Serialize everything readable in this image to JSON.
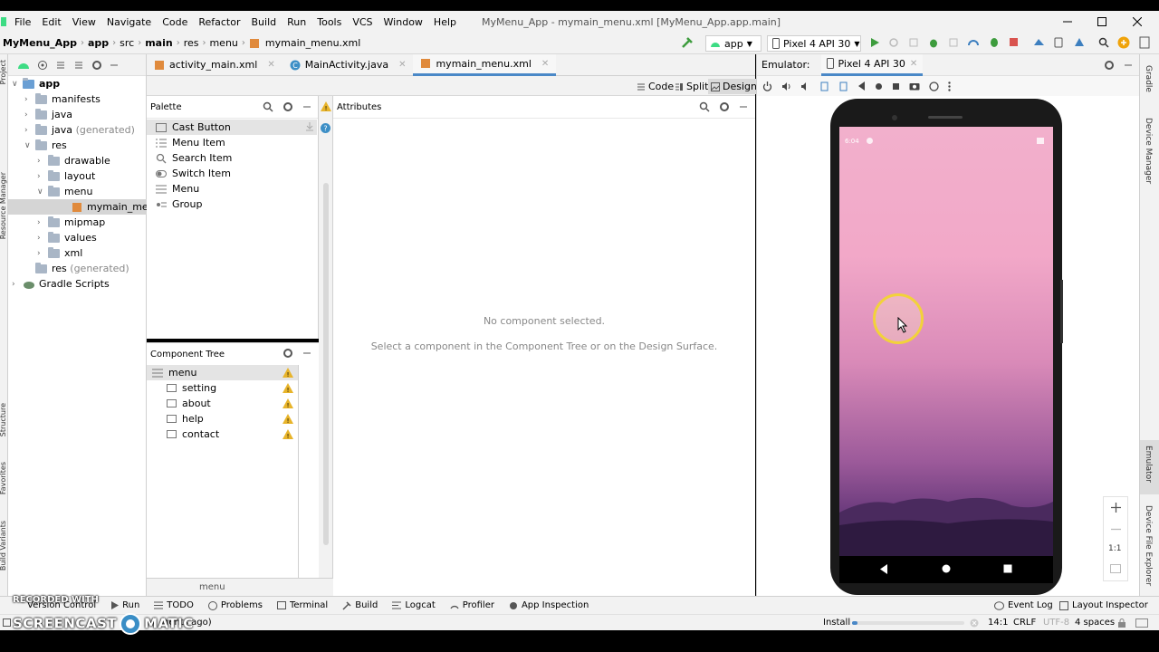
{
  "menubar": {
    "items": [
      "File",
      "Edit",
      "View",
      "Navigate",
      "Code",
      "Refactor",
      "Build",
      "Run",
      "Tools",
      "VCS",
      "Window",
      "Help"
    ],
    "window_title": "MyMenu_App - mymain_menu.xml [MyMenu_App.app.main]"
  },
  "breadcrumb": [
    "MyMenu_App",
    "app",
    "src",
    "main",
    "res",
    "menu",
    "mymain_menu.xml"
  ],
  "toolbar": {
    "run_config": "app",
    "device": "Pixel 4 API 30"
  },
  "project_tree": [
    {
      "label": "app",
      "depth": 0,
      "expanded": true,
      "bold": true
    },
    {
      "label": "manifests",
      "depth": 1
    },
    {
      "label": "java",
      "depth": 1
    },
    {
      "label": "java",
      "suffix": "(generated)",
      "depth": 1
    },
    {
      "label": "res",
      "depth": 1,
      "expanded": true
    },
    {
      "label": "drawable",
      "depth": 2
    },
    {
      "label": "layout",
      "depth": 2
    },
    {
      "label": "menu",
      "depth": 2,
      "expanded": true
    },
    {
      "label": "mymain_menu.x",
      "depth": 3,
      "selected": true
    },
    {
      "label": "mipmap",
      "depth": 2
    },
    {
      "label": "values",
      "depth": 2
    },
    {
      "label": "xml",
      "depth": 2
    },
    {
      "label": "res",
      "suffix": "(generated)",
      "depth": 1
    },
    {
      "label": "Gradle Scripts",
      "depth": 0
    }
  ],
  "editor_tabs": [
    {
      "label": "activity_main.xml",
      "active": false
    },
    {
      "label": "MainActivity.java",
      "active": false
    },
    {
      "label": "mymain_menu.xml",
      "active": true
    }
  ],
  "modes": [
    "Code",
    "Split",
    "Design"
  ],
  "palette": {
    "title": "Palette",
    "items": [
      "Cast Button",
      "Menu Item",
      "Search Item",
      "Switch Item",
      "Menu",
      "Group"
    ]
  },
  "attributes": {
    "title": "Attributes",
    "empty_title": "No component selected.",
    "empty_hint": "Select a component in the Component Tree or on the Design Surface."
  },
  "component_tree": {
    "title": "Component Tree",
    "root": "menu",
    "children": [
      "setting",
      "about",
      "help",
      "contact"
    ],
    "footer": "menu"
  },
  "emulator": {
    "label": "Emulator:",
    "device_tab": "Pixel 4 API 30",
    "status_time": "6:04",
    "zoom_label": "1:1"
  },
  "right_strip": [
    "Gradle",
    "Device Manager",
    "Emulator",
    "Device File Explorer"
  ],
  "left_strip": [
    "Project",
    "Resource Manager",
    "Structure",
    "Favorites",
    "Build Variants"
  ],
  "bottom_tabs": [
    "Version Control",
    "Run",
    "TODO",
    "Problems",
    "Terminal",
    "Build",
    "Logcat",
    "Profiler",
    "App Inspection"
  ],
  "bottom_right_tabs": [
    "Event Log",
    "Layout Inspector"
  ],
  "statusbar": {
    "left_text": "nents ago)",
    "install": "Install",
    "position": "14:1",
    "line_sep": "CRLF",
    "encoding": "UTF-8",
    "indent": "4 spaces"
  },
  "watermark": {
    "line1": "RECORDED WITH",
    "line2": "SCREENCAST",
    "line3": "MATIC"
  },
  "colors": {
    "accent": "#4a88c7",
    "warning": "#e8b42a",
    "run_green": "#3d9c3d"
  }
}
